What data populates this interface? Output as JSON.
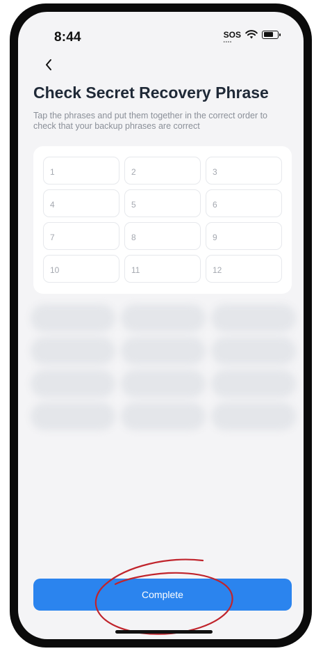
{
  "status_bar": {
    "time": "8:44",
    "sos_label": "SOS",
    "icons": [
      "wifi-icon",
      "battery-icon"
    ]
  },
  "nav": {
    "back_icon": "chevron-left-icon"
  },
  "header": {
    "title": "Check Secret Recovery Phrase",
    "subtitle": "Tap the phrases and put them together in the correct order to check that your backup phrases are correct"
  },
  "slots": [
    "1",
    "2",
    "3",
    "4",
    "5",
    "6",
    "7",
    "8",
    "9",
    "10",
    "11",
    "12"
  ],
  "footer": {
    "complete_label": "Complete"
  },
  "colors": {
    "primary": "#2b84ee",
    "background": "#f4f4f6",
    "annotation": "#c0242c"
  }
}
